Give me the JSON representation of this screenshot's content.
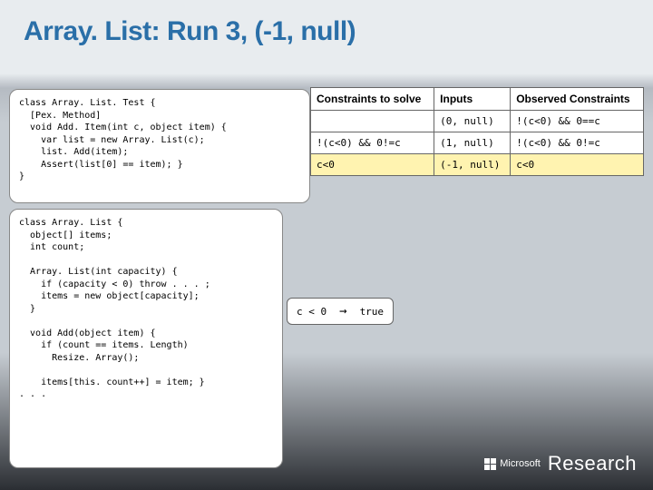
{
  "title": "Array. List: Run 3, (-1, null)",
  "code1": "class Array. List. Test {\n  [Pex. Method]\n  void Add. Item(int c, object item) {\n    var list = new Array. List(c);\n    list. Add(item);\n    Assert(list[0] == item); }\n}",
  "code2": "class Array. List {\n  object[] items;\n  int count;\n\n  Array. List(int capacity) {\n    if (capacity < 0) throw . . . ;\n    items = new object[capacity];\n  }\n\n  void Add(object item) {\n    if (count == items. Length)\n      Resize. Array();\n\n    items[this. count++] = item; }\n. . .",
  "table": {
    "headers": [
      "Constraints to solve",
      "Inputs",
      "Observed Constraints"
    ],
    "rows": [
      {
        "c0": "",
        "c1": "(0, null)",
        "c2": "!(c<0) && 0==c",
        "hl": []
      },
      {
        "c0": "!(c<0) && 0!=c",
        "c1": "(1, null)",
        "c2": "!(c<0) && 0!=c",
        "hl": []
      },
      {
        "c0": "c<0",
        "c1": "(-1, null)",
        "c2": "c<0",
        "hl": [
          0,
          1,
          2
        ]
      }
    ]
  },
  "callout": {
    "lhs": "c < 0",
    "arrow": "→",
    "rhs": "true"
  },
  "footer": {
    "brand": "Microsoft",
    "unit": "Research"
  }
}
